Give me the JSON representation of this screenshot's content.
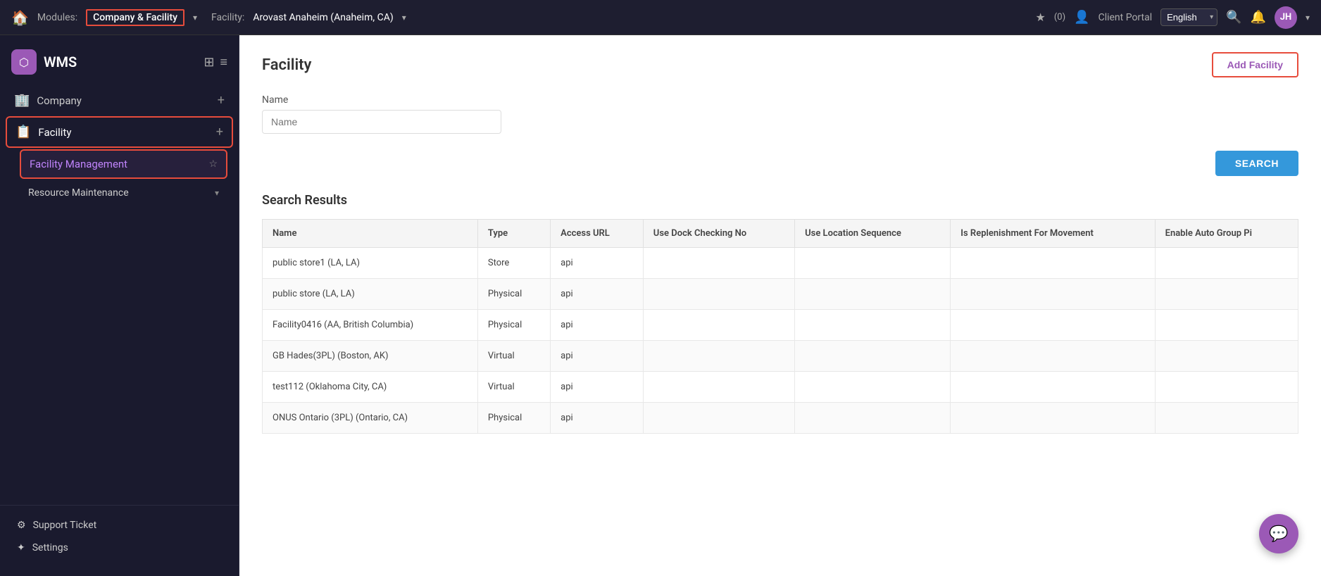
{
  "app": {
    "name": "WMS",
    "logo_initial": "⬡"
  },
  "top_nav": {
    "home_icon": "🏠",
    "modules_label": "Modules:",
    "module_name": "Company & Facility",
    "dropdown_arrow": "▾",
    "facility_label": "Facility:",
    "facility_name": "Arovast Anaheim  (Anaheim, CA)",
    "star_label": "★",
    "star_count": "(0)",
    "user_icon": "👤",
    "client_portal": "Client Portal",
    "language": "English",
    "search_icon": "🔍",
    "bell_icon": "🔔",
    "user_initials": "JH",
    "user_dropdown": "▾"
  },
  "sidebar": {
    "header_icons": [
      "⊞",
      "≡"
    ],
    "items": [
      {
        "id": "company",
        "icon": "🏢",
        "label": "Company",
        "has_plus": true
      },
      {
        "id": "facility",
        "icon": "📋",
        "label": "Facility",
        "has_plus": true,
        "active": true,
        "bordered": true
      }
    ],
    "sub_items": [
      {
        "id": "facility-management",
        "label": "Facility Management",
        "is_active": true,
        "has_star": true
      },
      {
        "id": "resource-maintenance",
        "label": "Resource Maintenance",
        "has_chevron": true
      }
    ],
    "footer_items": [
      {
        "id": "support-ticket",
        "icon": "⚙",
        "label": "Support Ticket"
      },
      {
        "id": "settings",
        "icon": "✦",
        "label": "Settings"
      }
    ]
  },
  "content": {
    "title": "Facility",
    "add_button_label": "Add Facility",
    "name_label": "Name",
    "name_placeholder": "Name",
    "search_button_label": "SEARCH",
    "results_title": "Search Results",
    "table_headers": [
      "Name",
      "Type",
      "Access URL",
      "Use Dock Checking No",
      "Use Location Sequence",
      "Is Replenishment For Movement",
      "Enable Auto Group Pi"
    ],
    "table_rows": [
      {
        "name": "public store1 (LA, LA)",
        "type": "Store",
        "access_url": "api",
        "dock": "",
        "location": "",
        "replenishment": "",
        "auto_group": ""
      },
      {
        "name": "public store (LA, LA)",
        "type": "Physical",
        "access_url": "api",
        "dock": "",
        "location": "",
        "replenishment": "",
        "auto_group": ""
      },
      {
        "name": "Facility0416 (AA, British Columbia)",
        "type": "Physical",
        "access_url": "api",
        "dock": "",
        "location": "",
        "replenishment": "",
        "auto_group": ""
      },
      {
        "name": "GB Hades(3PL) (Boston, AK)",
        "type": "Virtual",
        "access_url": "api",
        "dock": "",
        "location": "",
        "replenishment": "",
        "auto_group": ""
      },
      {
        "name": "test112 (Oklahoma City, CA)",
        "type": "Virtual",
        "access_url": "api",
        "dock": "",
        "location": "",
        "replenishment": "",
        "auto_group": ""
      },
      {
        "name": "ONUS Ontario (3PL) (Ontario, CA)",
        "type": "Physical",
        "access_url": "api",
        "dock": "",
        "location": "",
        "replenishment": "",
        "auto_group": ""
      }
    ]
  },
  "fab": {
    "icon": "💬"
  }
}
